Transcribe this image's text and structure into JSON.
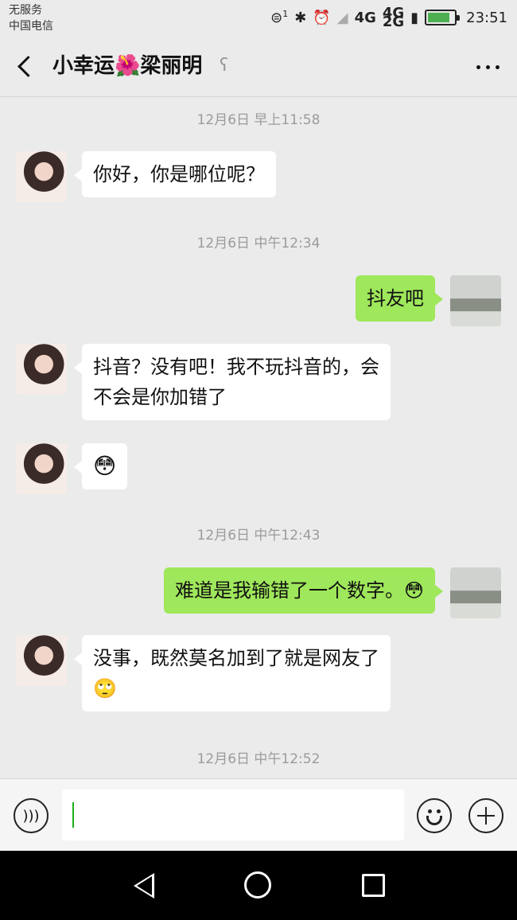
{
  "status_bar": {
    "carrier_line1": "无服务",
    "carrier_line2": "中国电信",
    "hd_badge": "1",
    "network": "4G",
    "network_small_top": "4G",
    "network_small_bottom": "2G",
    "time": "23:51",
    "battery_level": 0.85
  },
  "header": {
    "title": "小幸运🌺梁丽明",
    "earpiece_icon": "ear-icon",
    "more_icon": "more-icon"
  },
  "messages": [
    {
      "type": "timestamp",
      "text": "12月6日 早上11:58"
    },
    {
      "type": "incoming",
      "text": "你好，你是哪位呢？"
    },
    {
      "type": "timestamp",
      "text": "12月6日 中午12:34"
    },
    {
      "type": "outgoing",
      "text": "抖友吧"
    },
    {
      "type": "incoming",
      "text_line1": "抖音？没有吧！我不玩抖音的，会",
      "text_line2": "不会是你加错了"
    },
    {
      "type": "incoming",
      "text": "😳"
    },
    {
      "type": "timestamp",
      "text": "12月6日 中午12:43"
    },
    {
      "type": "outgoing",
      "text": "难道是我输错了一个数字。😳"
    },
    {
      "type": "incoming",
      "text_line1": "没事，既然莫名加到了就是网友了",
      "text_line2": "🙄"
    },
    {
      "type": "timestamp",
      "text": "12月6日 中午12:52"
    }
  ],
  "input_bar": {
    "text": "",
    "voice_icon": "voice-icon",
    "emoji_icon": "emoji-icon",
    "plus_icon": "plus-icon"
  },
  "colors": {
    "outgoing_bubble": "#9fe75b",
    "incoming_bubble": "#ffffff",
    "background": "#ebebeb"
  }
}
